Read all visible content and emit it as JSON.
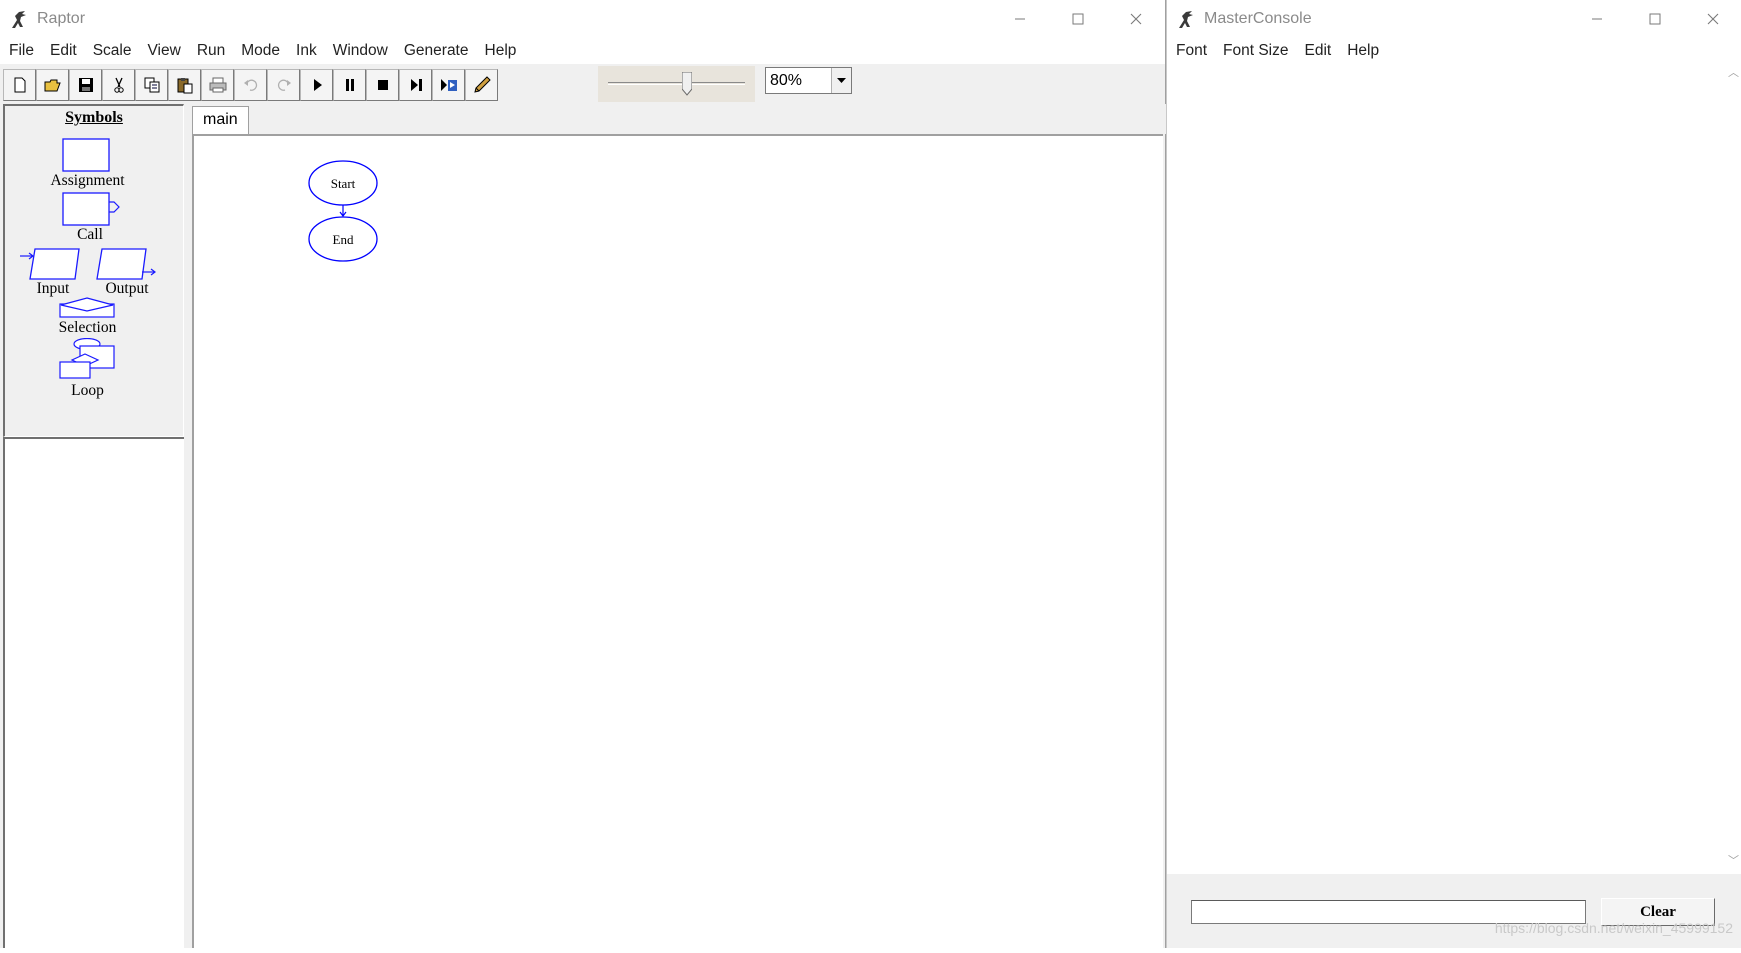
{
  "raptor": {
    "title": "Raptor",
    "menu": [
      "File",
      "Edit",
      "Scale",
      "View",
      "Run",
      "Mode",
      "Ink",
      "Window",
      "Generate",
      "Help"
    ],
    "zoom_value": "80%",
    "symbols": {
      "title": "Symbols",
      "assignment": "Assignment",
      "call": "Call",
      "input": "Input",
      "output": "Output",
      "selection": "Selection",
      "loop": "Loop"
    },
    "tab_label": "main",
    "flowchart": {
      "start_label": "Start",
      "end_label": "End"
    },
    "colors": {
      "flow_stroke": "#0000ff",
      "symbol_stroke": "#1a1aff"
    }
  },
  "console": {
    "title": "MasterConsole",
    "menu": [
      "Font",
      "Font Size",
      "Edit",
      "Help"
    ],
    "input_value": "",
    "clear_label": "Clear",
    "watermark": "https://blog.csdn.net/weixin_45999152"
  }
}
